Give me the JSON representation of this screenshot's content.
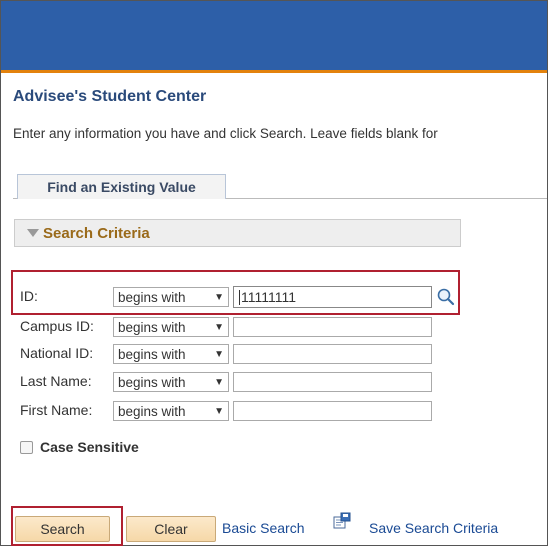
{
  "page": {
    "title": "Advisee's Student Center",
    "instructions": "Enter any information you have and click Search. Leave fields blank for"
  },
  "tabs": [
    {
      "label": "Find an Existing Value",
      "active": true
    }
  ],
  "search_criteria": {
    "section_label": "Search Criteria",
    "fields": [
      {
        "label": "ID:",
        "operator": "begins with",
        "value": "11111111"
      },
      {
        "label": "Campus ID:",
        "operator": "begins with",
        "value": ""
      },
      {
        "label": "National ID:",
        "operator": "begins with",
        "value": ""
      },
      {
        "label": "Last Name:",
        "operator": "begins with",
        "value": ""
      },
      {
        "label": "First Name:",
        "operator": "begins with",
        "value": ""
      }
    ],
    "case_sensitive_label": "Case Sensitive",
    "dropdown_arrow": "▼"
  },
  "actions": {
    "search_label": "Search",
    "clear_label": "Clear",
    "basic_search_label": "Basic Search",
    "save_search_label": "Save Search Criteria"
  },
  "icons": {
    "lookup": "magnifier-icon",
    "save_search": "save-search-icon",
    "section_toggle": "triangle-down-icon",
    "dropdown": "chevron-down-icon"
  },
  "colors": {
    "banner": "#2d5fa8",
    "banner_accent": "#e3820d",
    "title": "#2a4a7b",
    "section_label": "#9a6a1a",
    "link": "#1a4a94",
    "highlight": "#b02030"
  }
}
